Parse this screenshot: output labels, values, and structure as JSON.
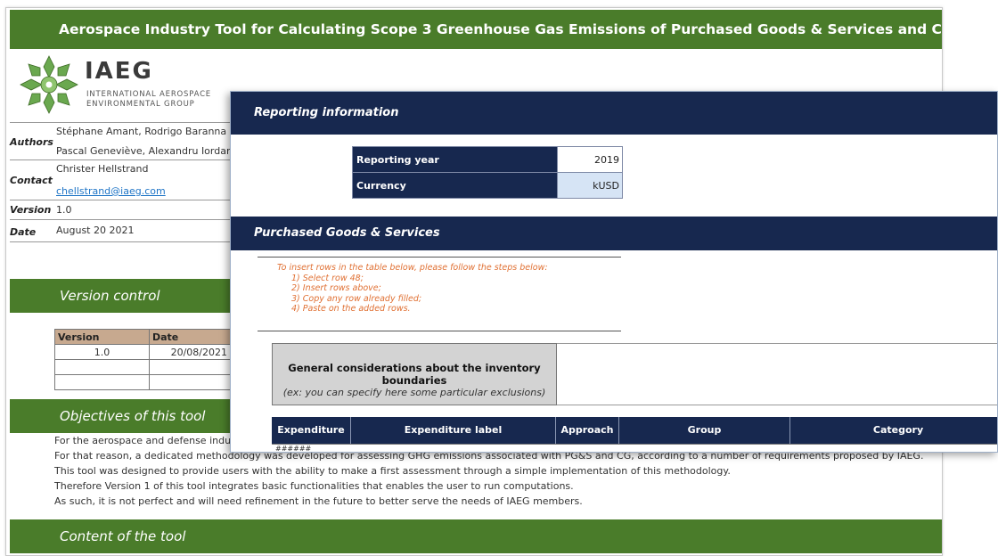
{
  "header": {
    "title": "Aerospace Industry Tool for Calculating Scope 3 Greenhouse Gas Emissions of Purchased Goods & Services and Capital Goods"
  },
  "logo": {
    "name": "IAEG",
    "tagline": "INTERNATIONAL AEROSPACE\nENVIRONMENTAL GROUP"
  },
  "meta": {
    "authors_label": "Authors",
    "authors_line1": "Stéphane Amant, Rodrigo Baranna",
    "authors_line2": "Pascal Geneviève, Alexandru Iordan",
    "contact_label": "Contact",
    "contact_name": "Christer Hellstrand",
    "contact_email": "chellstrand@iaeg.com",
    "version_label": "Version",
    "version_value": "1.0",
    "date_label": "Date",
    "date_value": "August 20 2021"
  },
  "version_control": {
    "title": "Version control",
    "columns": [
      "Version",
      "Date"
    ],
    "rows": [
      [
        "1.0",
        "20/08/2021"
      ],
      [
        "",
        ""
      ],
      [
        "",
        ""
      ]
    ]
  },
  "objectives": {
    "title": "Objectives of this tool",
    "lines": [
      "For the aerospace and defense indu",
      "For that reason, a dedicated methodology was developed for assessing GHG emissions associated with PG&S and CG, according to a number of requirements proposed by IAEG.",
      "This tool was designed to provide users with the ability to make a first assessment through a simple implementation of this methodology.",
      "Therefore Version 1 of this tool integrates basic functionalities that enables the user to run computations.",
      "As such, it is not perfect and will need refinement in the future to better serve the needs of IAEG members."
    ]
  },
  "content": {
    "title": "Content of the tool"
  },
  "reporting": {
    "title": "Reporting information",
    "year_label": "Reporting year",
    "year_value": "2019",
    "currency_label": "Currency",
    "currency_value": "kUSD"
  },
  "pgs": {
    "title": "Purchased Goods & Services",
    "instructions": {
      "intro": "To insert rows in the table below, please follow the steps below:",
      "steps": [
        "1) Select row 48;",
        "2) Insert rows above;",
        "3) Copy any row already filled;",
        "4) Paste on the added rows."
      ]
    },
    "general_title": "General considerations about the inventory boundaries",
    "general_sub": "(ex: you can specify here some particular exclusions)",
    "columns": [
      "Expenditure ID",
      "Expenditure label",
      "Approach",
      "Group",
      "Category"
    ],
    "first_cell": "######"
  },
  "colors": {
    "green": "#4a7c2a",
    "navy": "#17284f",
    "orange_text": "#e07033",
    "table_header_tan": "#c7a98f"
  }
}
